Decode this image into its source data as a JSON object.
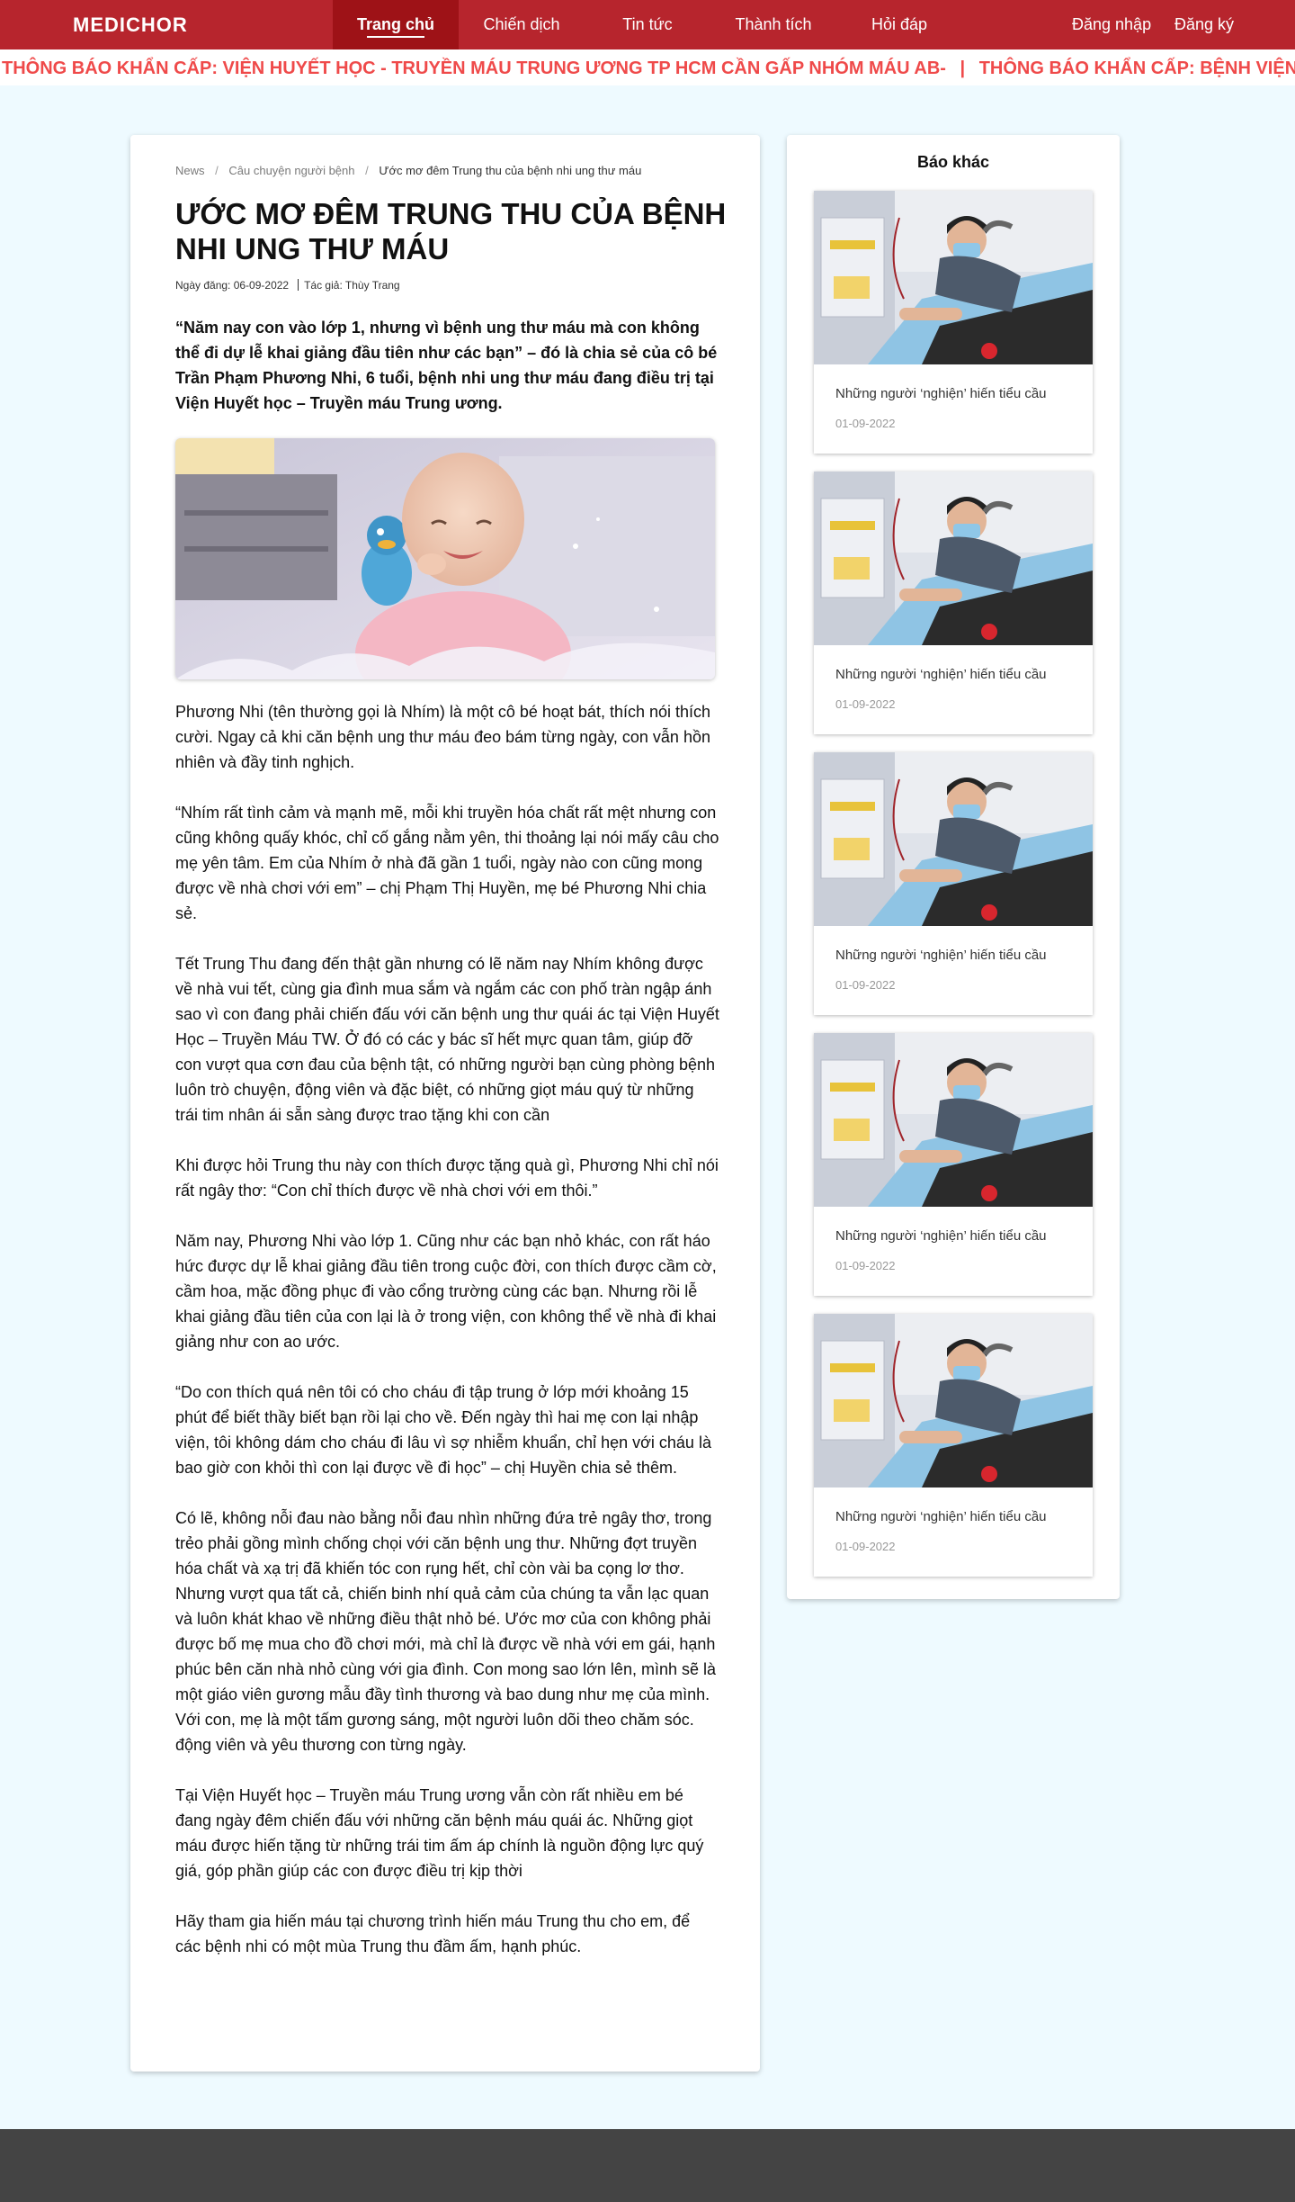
{
  "navbar": {
    "brand": "MEDICHOR",
    "items": [
      {
        "label": "Trang chủ",
        "active": true
      },
      {
        "label": "Chiến dịch",
        "active": false
      },
      {
        "label": "Tin tức",
        "active": false
      },
      {
        "label": "Thành tích",
        "active": false
      },
      {
        "label": "Hỏi đáp",
        "active": false
      }
    ],
    "login": "Đăng nhập",
    "register": "Đăng ký",
    "colors": {
      "bar": "#b7252d",
      "active": "#9e1217"
    }
  },
  "ticker": {
    "text": "THÔNG BÁO KHẨN CẤP: VIỆN HUYẾT HỌC - TRUYỀN MÁU TRUNG ƯƠNG TP HCM CẦN GẤP NHÓM MÁU AB-",
    "separator": "|",
    "text_repeat": "THÔNG BÁO KHẨN CẤP: BỆNH VIỆN",
    "color": "#ef4a4a"
  },
  "article": {
    "breadcrumb": [
      "News",
      "Câu chuyện người bệnh",
      "Ước mơ đêm Trung thu của bệnh nhi ung thư máu"
    ],
    "title": "ƯỚC MƠ ĐÊM TRUNG THU CỦA BỆNH NHI UNG THƯ MÁU",
    "date": "Ngày đăng: 06-09-2022",
    "author": "Tác giả: Thùy Trang",
    "lead": "“Năm nay con vào lớp 1, nhưng vì bệnh ung thư máu mà con không thể đi dự lễ khai giảng đầu tiên như các bạn” – đó là chia sẻ của cô bé Trần Phạm Phương Nhi, 6 tuổi, bệnh nhi ung thư máu đang điều trị tại Viện Huyết học – Truyền máu Trung ương.",
    "paragraphs": [
      "Phương Nhi (tên thường gọi là Nhím) là một cô bé hoạt bát, thích nói thích cười. Ngay cả khi căn bệnh ung thư máu đeo bám từng ngày, con vẫn hồn nhiên và đầy tinh nghịch.",
      "“Nhím rất tình cảm và mạnh mẽ, mỗi khi truyền hóa chất rất mệt nhưng con cũng không quấy khóc, chỉ cố gắng nằm yên, thi thoảng lại nói mấy câu cho mẹ yên tâm. Em của Nhím ở nhà đã gần 1 tuổi, ngày nào con cũng mong được về nhà chơi với em” – chị Phạm Thị Huyền, mẹ bé Phương Nhi chia sẻ.",
      "Tết Trung Thu đang đến thật gần nhưng có lẽ năm nay Nhím không được về nhà vui tết, cùng gia đình mua sắm và ngắm các con phố tràn ngập ánh sao vì con đang phải chiến đấu với căn bệnh ung thư quái ác tại Viện Huyết Học – Truyền Máu TW. Ở đó có các y bác sĩ hết mực quan tâm, giúp đỡ con vượt qua cơn đau của bệnh tật, có những người bạn cùng phòng bệnh luôn trò chuyện, động viên và đặc biệt, có những giọt máu quý từ những trái tim nhân ái sẵn sàng được trao tặng khi con cần",
      "Khi được hỏi Trung thu này con thích được tặng quà gì, Phương Nhi chỉ nói rất ngây thơ: “Con chỉ thích được về nhà chơi với em thôi.”",
      "Năm nay, Phương Nhi vào lớp 1. Cũng như các bạn nhỏ khác, con rất háo hức được dự lễ khai giảng đầu tiên trong cuộc đời, con thích được cầm cờ, cầm hoa, mặc đồng phục đi vào cổng trường cùng các bạn. Nhưng rồi lễ khai giảng đầu tiên của con lại là ở trong viện, con không thể về nhà đi khai giảng như con ao ước.",
      "“Do con thích quá nên tôi có cho cháu đi tập trung ở lớp mới khoảng 15 phút để biết thầy biết bạn rồi lại cho về. Đến ngày thì hai mẹ con lại nhập viện, tôi không dám cho cháu đi lâu vì sợ nhiễm khuẩn, chỉ hẹn với cháu là bao giờ con khỏi thì con lại được về đi học” – chị Huyền chia sẻ thêm.",
      "Có lẽ, không nỗi đau nào bằng nỗi đau nhìn những đứa trẻ ngây thơ, trong trẻo phải gồng mình chống chọi với căn bệnh ung thư. Những đợt truyền hóa chất và xạ trị đã khiến tóc con rụng hết, chỉ còn vài ba cọng lơ thơ. Nhưng vượt qua tất cả, chiến binh nhí quả cảm của chúng ta vẫn lạc quan và luôn khát khao về những điều thật nhỏ bé. Ước mơ của con không phải được bố mẹ mua cho đồ chơi mới, mà chỉ là được về nhà với em gái, hạnh phúc bên căn nhà nhỏ cùng với gia đình. Con mong sao lớn lên, mình sẽ là một giáo viên gương mẫu đầy tình thương và bao dung như mẹ của mình. Với con, mẹ là một tấm gương sáng, một người luôn dõi theo chăm sóc. động viên và yêu thương con từng ngày.",
      "Tại Viện Huyết học – Truyền máu Trung ương vẫn còn rất nhiều em bé đang ngày đêm chiến đấu với những căn bệnh máu quái ác. Những giọt máu được hiến tặng từ những trái tim ấm áp chính là nguồn động lực quý giá, góp phần giúp các con được điều trị kịp thời",
      "Hãy tham gia hiến máu tại chương trình hiến máu Trung thu cho em, để các bệnh nhi có một mùa Trung thu đầm ấm, hạnh phúc."
    ]
  },
  "sidebar": {
    "title": "Báo khác",
    "items": [
      {
        "title": "Những người ‘nghiện’ hiến tiểu cầu",
        "date": "01-09-2022"
      },
      {
        "title": "Những người ‘nghiện’ hiến tiểu cầu",
        "date": "01-09-2022"
      },
      {
        "title": "Những người ‘nghiện’ hiến tiểu cầu",
        "date": "01-09-2022"
      },
      {
        "title": "Những người ‘nghiện’ hiến tiểu cầu",
        "date": "01-09-2022"
      },
      {
        "title": "Những người ‘nghiện’ hiến tiểu cầu",
        "date": "01-09-2022"
      }
    ]
  },
  "footer": {
    "color": "#444444"
  }
}
